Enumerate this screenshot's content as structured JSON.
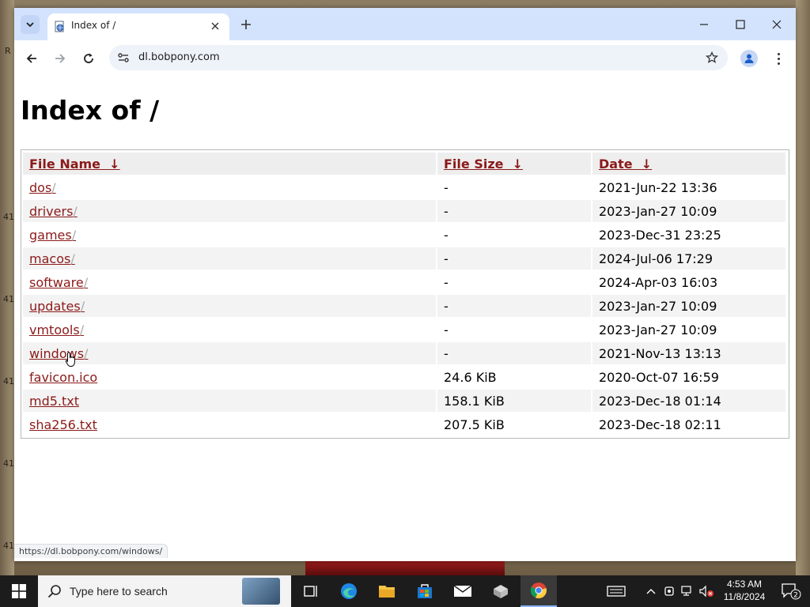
{
  "browser": {
    "tab_title": "Index of /",
    "url": "dl.bobpony.com",
    "status_url": "https://dl.bobpony.com/windows/"
  },
  "page": {
    "title": "Index of /",
    "table": {
      "headers": {
        "name": "File Name",
        "size": "File Size",
        "date": "Date",
        "sort_arrow": "↓"
      },
      "rows": [
        {
          "name": "dos",
          "slash": "/",
          "size": "-",
          "date": "2021-Jun-22 13:36"
        },
        {
          "name": "drivers",
          "slash": "/",
          "size": "-",
          "date": "2023-Jan-27 10:09"
        },
        {
          "name": "games",
          "slash": "/",
          "size": "-",
          "date": "2023-Dec-31 23:25"
        },
        {
          "name": "macos",
          "slash": "/",
          "size": "-",
          "date": "2024-Jul-06 17:29"
        },
        {
          "name": "software",
          "slash": "/",
          "size": "-",
          "date": "2024-Apr-03 16:03"
        },
        {
          "name": "updates",
          "slash": "/",
          "size": "-",
          "date": "2023-Jan-27 10:09"
        },
        {
          "name": "vmtools",
          "slash": "/",
          "size": "-",
          "date": "2023-Jan-27 10:09"
        },
        {
          "name": "windows",
          "slash": "/",
          "size": "-",
          "date": "2021-Nov-13 13:13"
        },
        {
          "name": "favicon.ico",
          "slash": "",
          "size": "24.6 KiB",
          "date": "2020-Oct-07 16:59"
        },
        {
          "name": "md5.txt",
          "slash": "",
          "size": "158.1 KiB",
          "date": "2023-Dec-18 01:14"
        },
        {
          "name": "sha256.txt",
          "slash": "",
          "size": "207.5 KiB",
          "date": "2023-Dec-18 02:11"
        }
      ]
    }
  },
  "taskbar": {
    "search_placeholder": "Type here to search",
    "time": "4:53 AM",
    "date": "11/8/2024",
    "notification_count": "2",
    "apps": [
      "task-view-icon",
      "edge-icon",
      "file-explorer-icon",
      "store-icon",
      "mail-icon",
      "app-icon",
      "chrome-icon"
    ]
  },
  "desktop": {
    "left_marks": [
      "R",
      "41",
      "41",
      "41",
      "41",
      "41"
    ]
  },
  "colors": {
    "link": "#8b1a1a",
    "tabstrip": "#d3e3fd",
    "taskbar": "#1c1c1c"
  }
}
